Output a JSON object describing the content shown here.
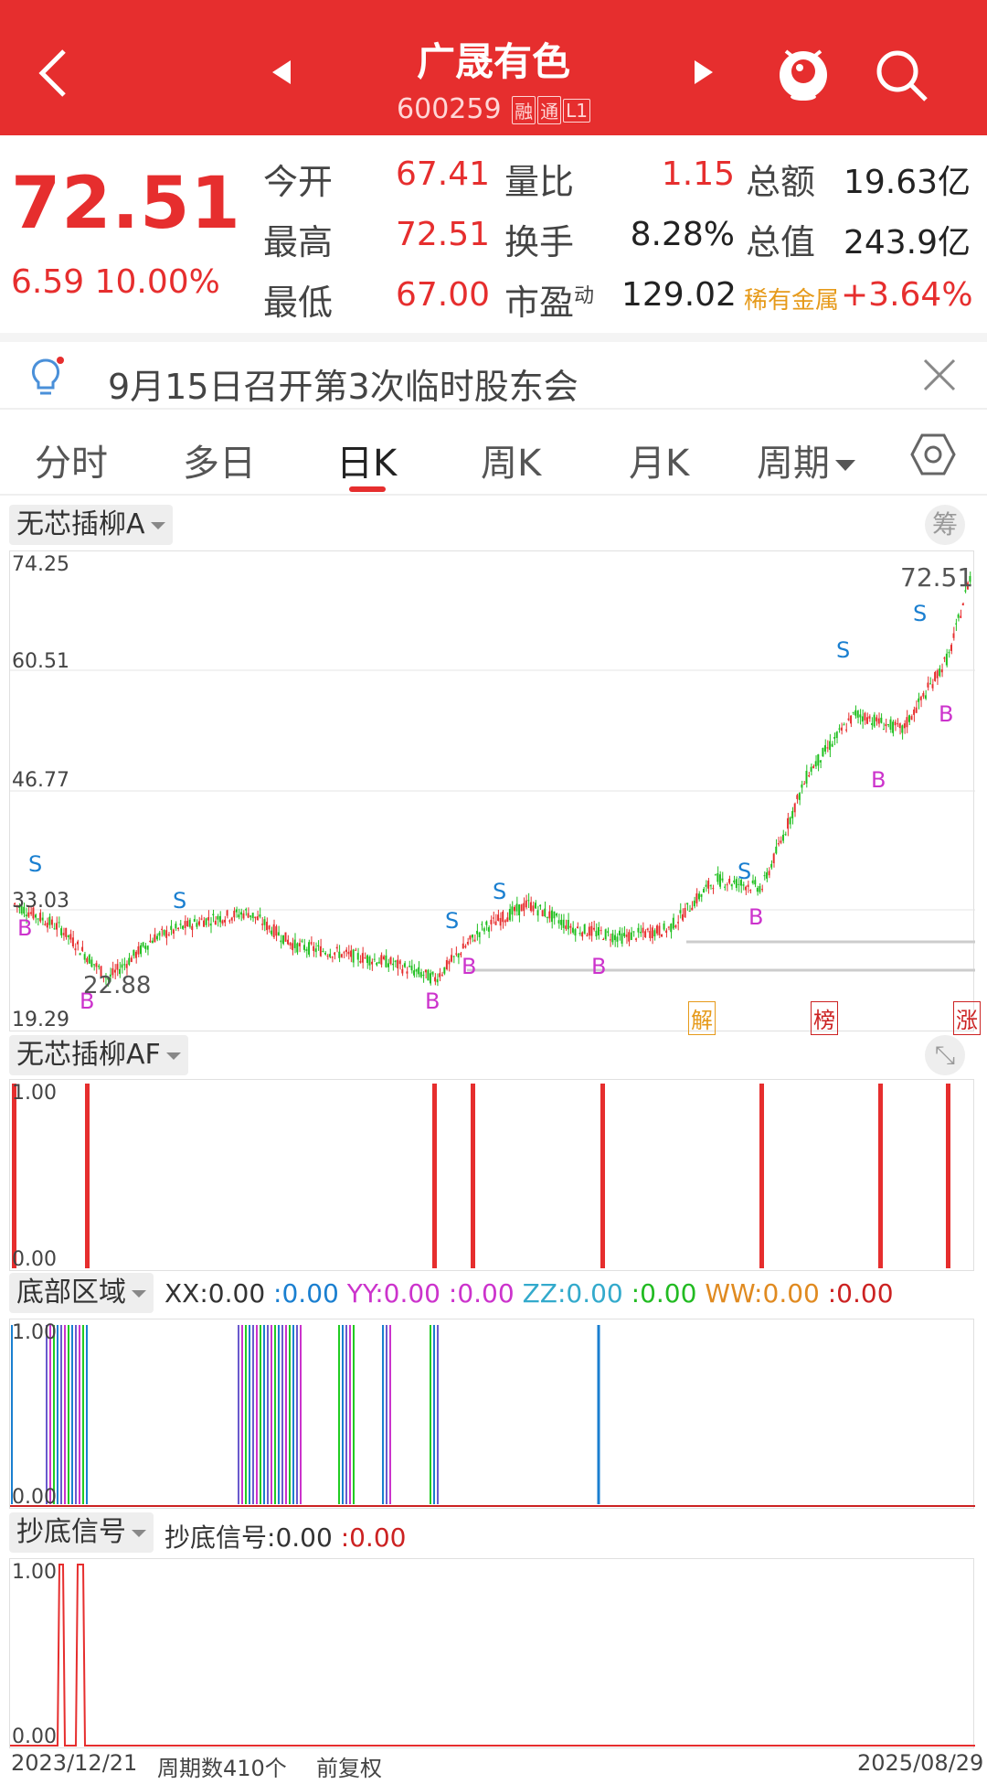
{
  "header": {
    "title": "广晟有色",
    "code": "600259",
    "tags": [
      "融",
      "通",
      "L1"
    ]
  },
  "quote": {
    "price": "72.51",
    "change": "6.59  10.00%",
    "rows": [
      {
        "l1": "今开",
        "v1": "67.41",
        "l2": "量比",
        "v2": "1.15",
        "l3": "总额",
        "v3": "19.63亿"
      },
      {
        "l1": "最高",
        "v1": "72.51",
        "l2": "换手",
        "v2": "8.28%",
        "l3": "总值",
        "v3": "243.9亿"
      },
      {
        "l1": "最低",
        "v1": "67.00",
        "l2": "市盈",
        "l2sup": "动",
        "v2": "129.02",
        "l3": "稀有金属",
        "v3": "+3.64%"
      }
    ]
  },
  "notice": {
    "text": "9月15日召开第3次临时股东会"
  },
  "tabs": [
    "分时",
    "多日",
    "日K",
    "周K",
    "月K",
    "周期"
  ],
  "active_tab": "日K",
  "chart_main": {
    "label": "无芯插柳A",
    "right_btn": "筹",
    "y_ticks": [
      "74.25",
      "60.51",
      "46.77",
      "33.03",
      "19.29"
    ],
    "high_label": "72.51",
    "low_label": "22.88",
    "markers": [
      "解",
      "榜",
      "涨"
    ]
  },
  "chart_af": {
    "label": "无芯插柳AF",
    "y_top": "1.00",
    "y_bottom": "0.00"
  },
  "chart_zone": {
    "label": "底部区域",
    "legend": [
      {
        "name": "XX:",
        "v1": "0.00",
        "v2": ":0.00",
        "c1": "#333333",
        "c2": "#1a7fd0"
      },
      {
        "name": "YY:",
        "v1": "0.00",
        "v2": ":0.00",
        "c1": "#cc33cc",
        "c2": "#cc33cc"
      },
      {
        "name": "ZZ:",
        "v1": "0.00",
        "v2": ":0.00",
        "c1": "#33aacc",
        "c2": "#22bb22"
      },
      {
        "name": "WW:",
        "v1": "0.00",
        "v2": ":0.00",
        "c1": "#e08a20",
        "c2": "#cc2222"
      }
    ],
    "y_top": "1.00",
    "y_bottom": "0.00"
  },
  "chart_signal": {
    "label": "抄底信号",
    "legend_name": "抄底信号:",
    "legend_v1": "0.00",
    "legend_v2": ":0.00",
    "y_top": "1.00",
    "y_bottom": "0.00"
  },
  "footer": {
    "start_date": "2023/12/21",
    "period_count": "周期数410个",
    "adjust": "前复权",
    "end_date": "2025/08/29"
  },
  "chart_data": {
    "type": "line",
    "title": "",
    "ylim": [
      19.29,
      74.25
    ],
    "x": [
      0,
      20,
      40,
      60,
      80,
      100,
      120,
      140,
      160,
      180,
      200,
      220,
      240,
      260,
      280,
      300,
      320,
      340,
      360,
      380,
      400,
      409
    ],
    "series": [
      {
        "name": "",
        "values": [
          33,
          30,
          24,
          29,
          31,
          32,
          28,
          27,
          26,
          24,
          30,
          33,
          30,
          29,
          30,
          36,
          35,
          49,
          56,
          54,
          63,
          72.51
        ]
      }
    ]
  }
}
